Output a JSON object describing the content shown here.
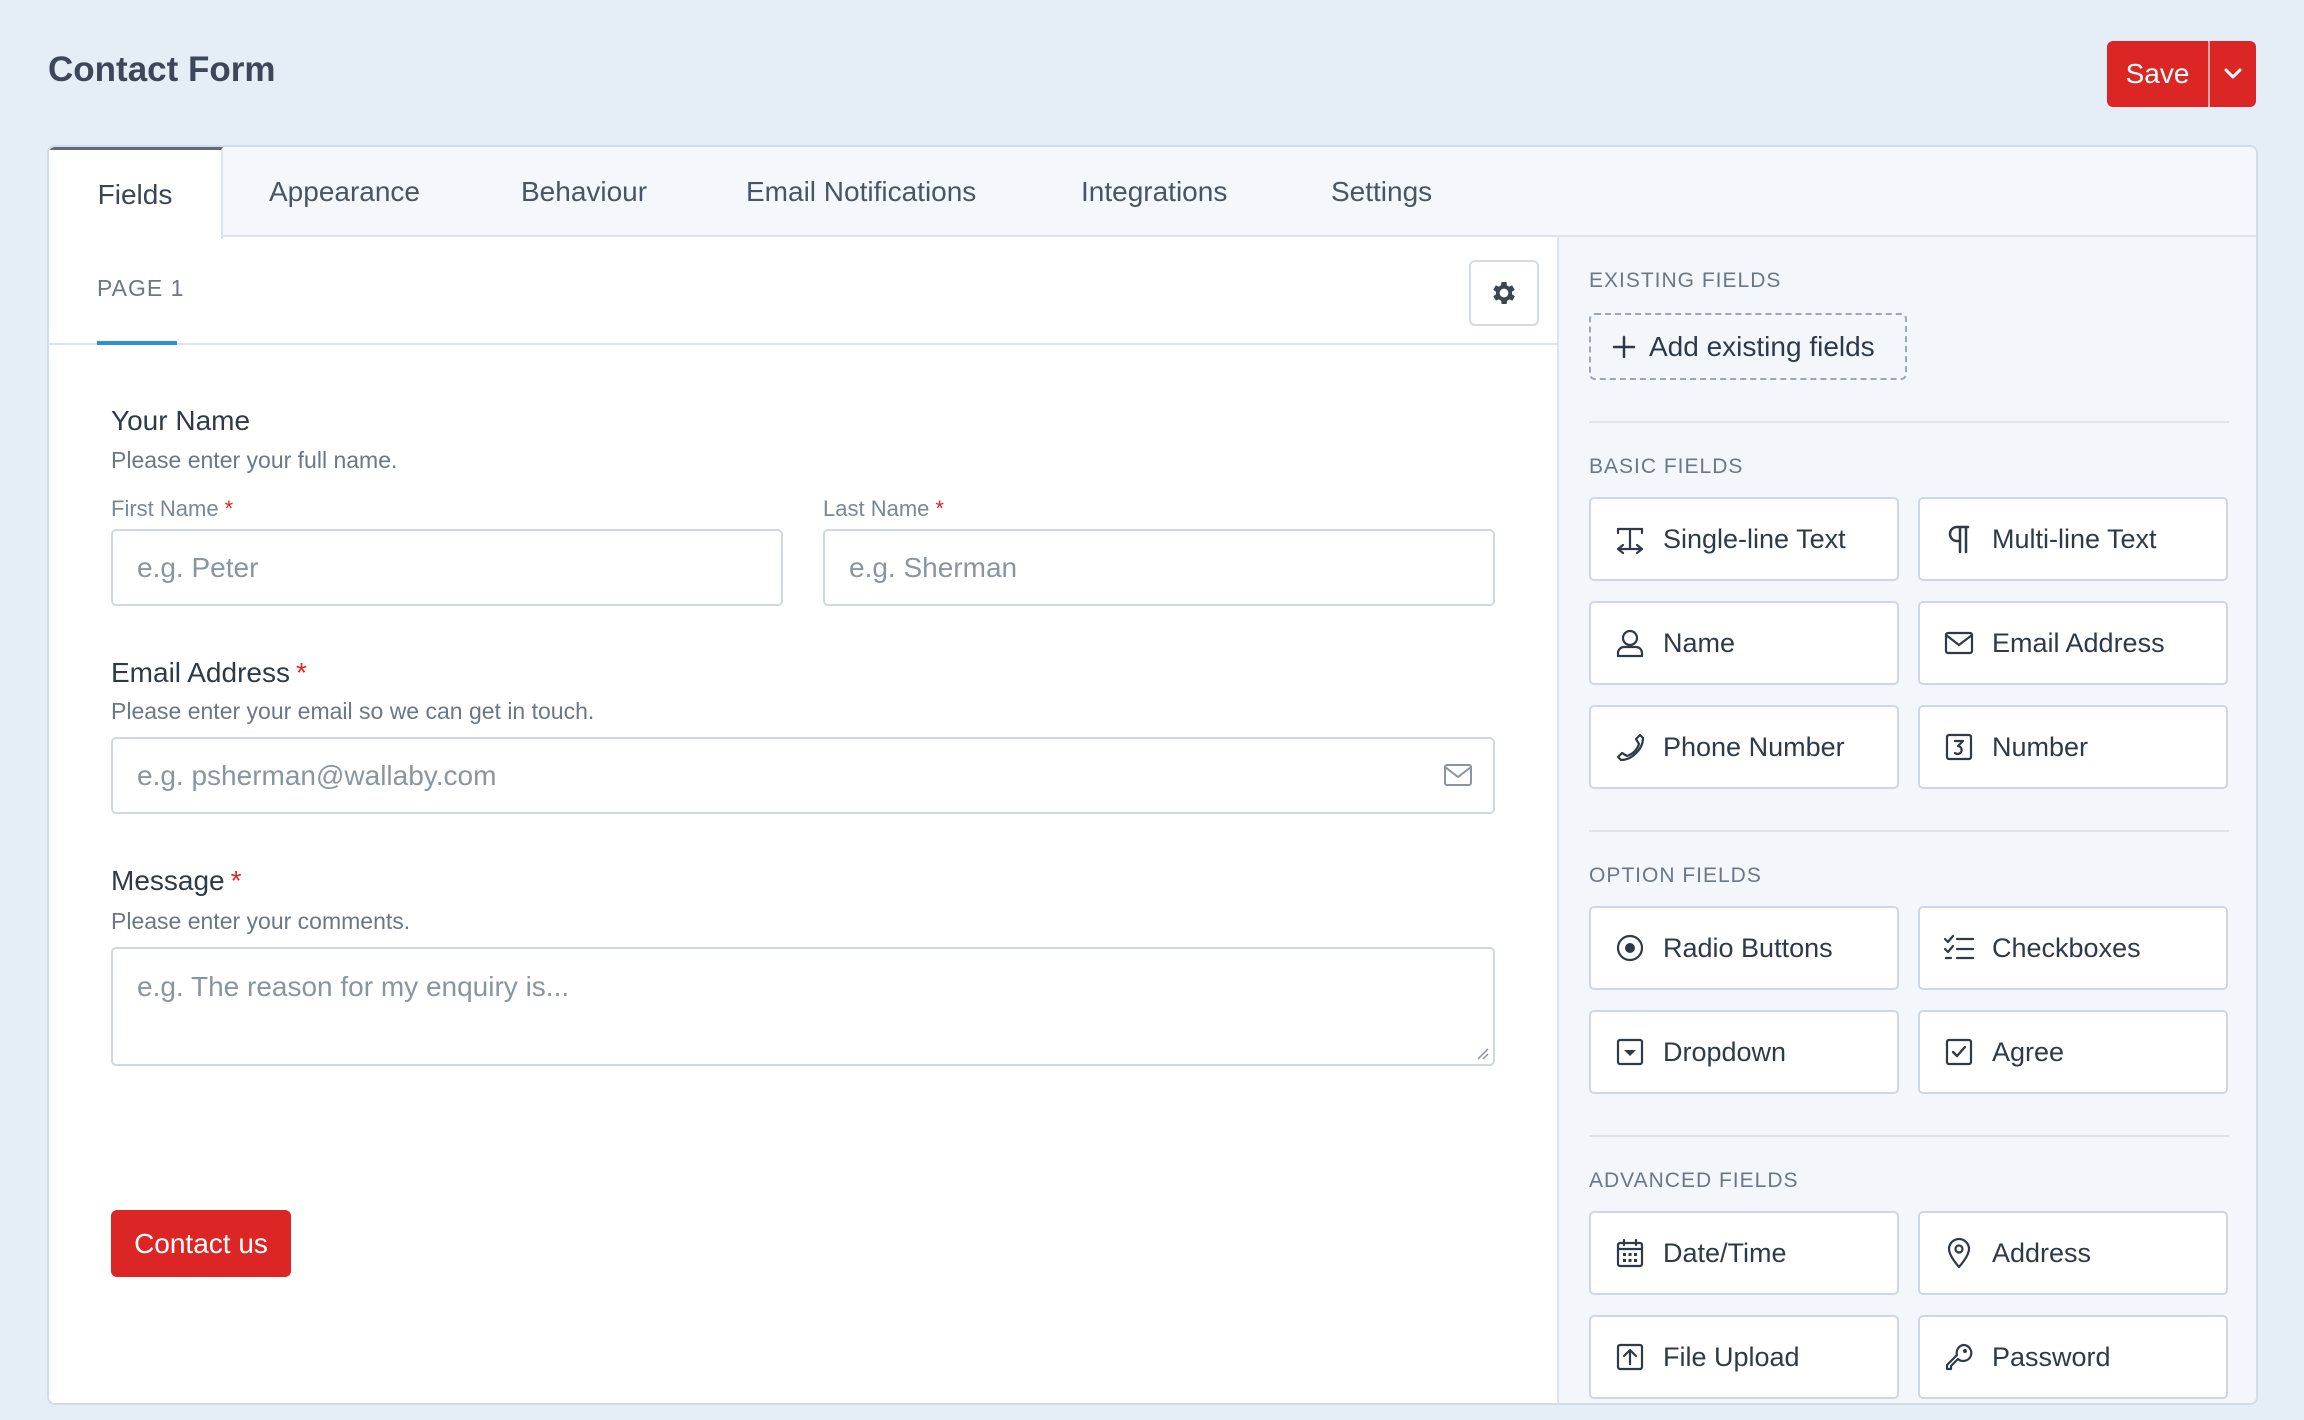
{
  "header": {
    "title": "Contact Form",
    "save_label": "Save"
  },
  "tabs": [
    "Fields",
    "Appearance",
    "Behaviour",
    "Email Notifications",
    "Integrations",
    "Settings"
  ],
  "page_tab": "PAGE 1",
  "form": {
    "name": {
      "title": "Your Name",
      "description": "Please enter your full name.",
      "first_label": "First Name",
      "first_placeholder": "e.g. Peter",
      "last_label": "Last Name",
      "last_placeholder": "e.g. Sherman"
    },
    "email": {
      "title": "Email Address",
      "description": "Please enter your email so we can get in touch.",
      "placeholder": "e.g. psherman@wallaby.com"
    },
    "message": {
      "title": "Message",
      "description": "Please enter your comments.",
      "placeholder": "e.g. The reason for my enquiry is..."
    },
    "required_mark": "*",
    "submit_label": "Contact us"
  },
  "sidebar": {
    "existing": {
      "label": "EXISTING FIELDS",
      "button": "Add existing fields"
    },
    "basic": {
      "label": "BASIC FIELDS",
      "items": [
        "Single-line Text",
        "Multi-line Text",
        "Name",
        "Email Address",
        "Phone Number",
        "Number"
      ]
    },
    "option": {
      "label": "OPTION FIELDS",
      "items": [
        "Radio Buttons",
        "Checkboxes",
        "Dropdown",
        "Agree"
      ]
    },
    "advanced": {
      "label": "ADVANCED FIELDS",
      "items": [
        "Date/Time",
        "Address",
        "File Upload",
        "Password"
      ]
    }
  },
  "colors": {
    "accent": "#dc2626",
    "tab_underline": "#2b90e0",
    "background": "#e5edf6"
  }
}
